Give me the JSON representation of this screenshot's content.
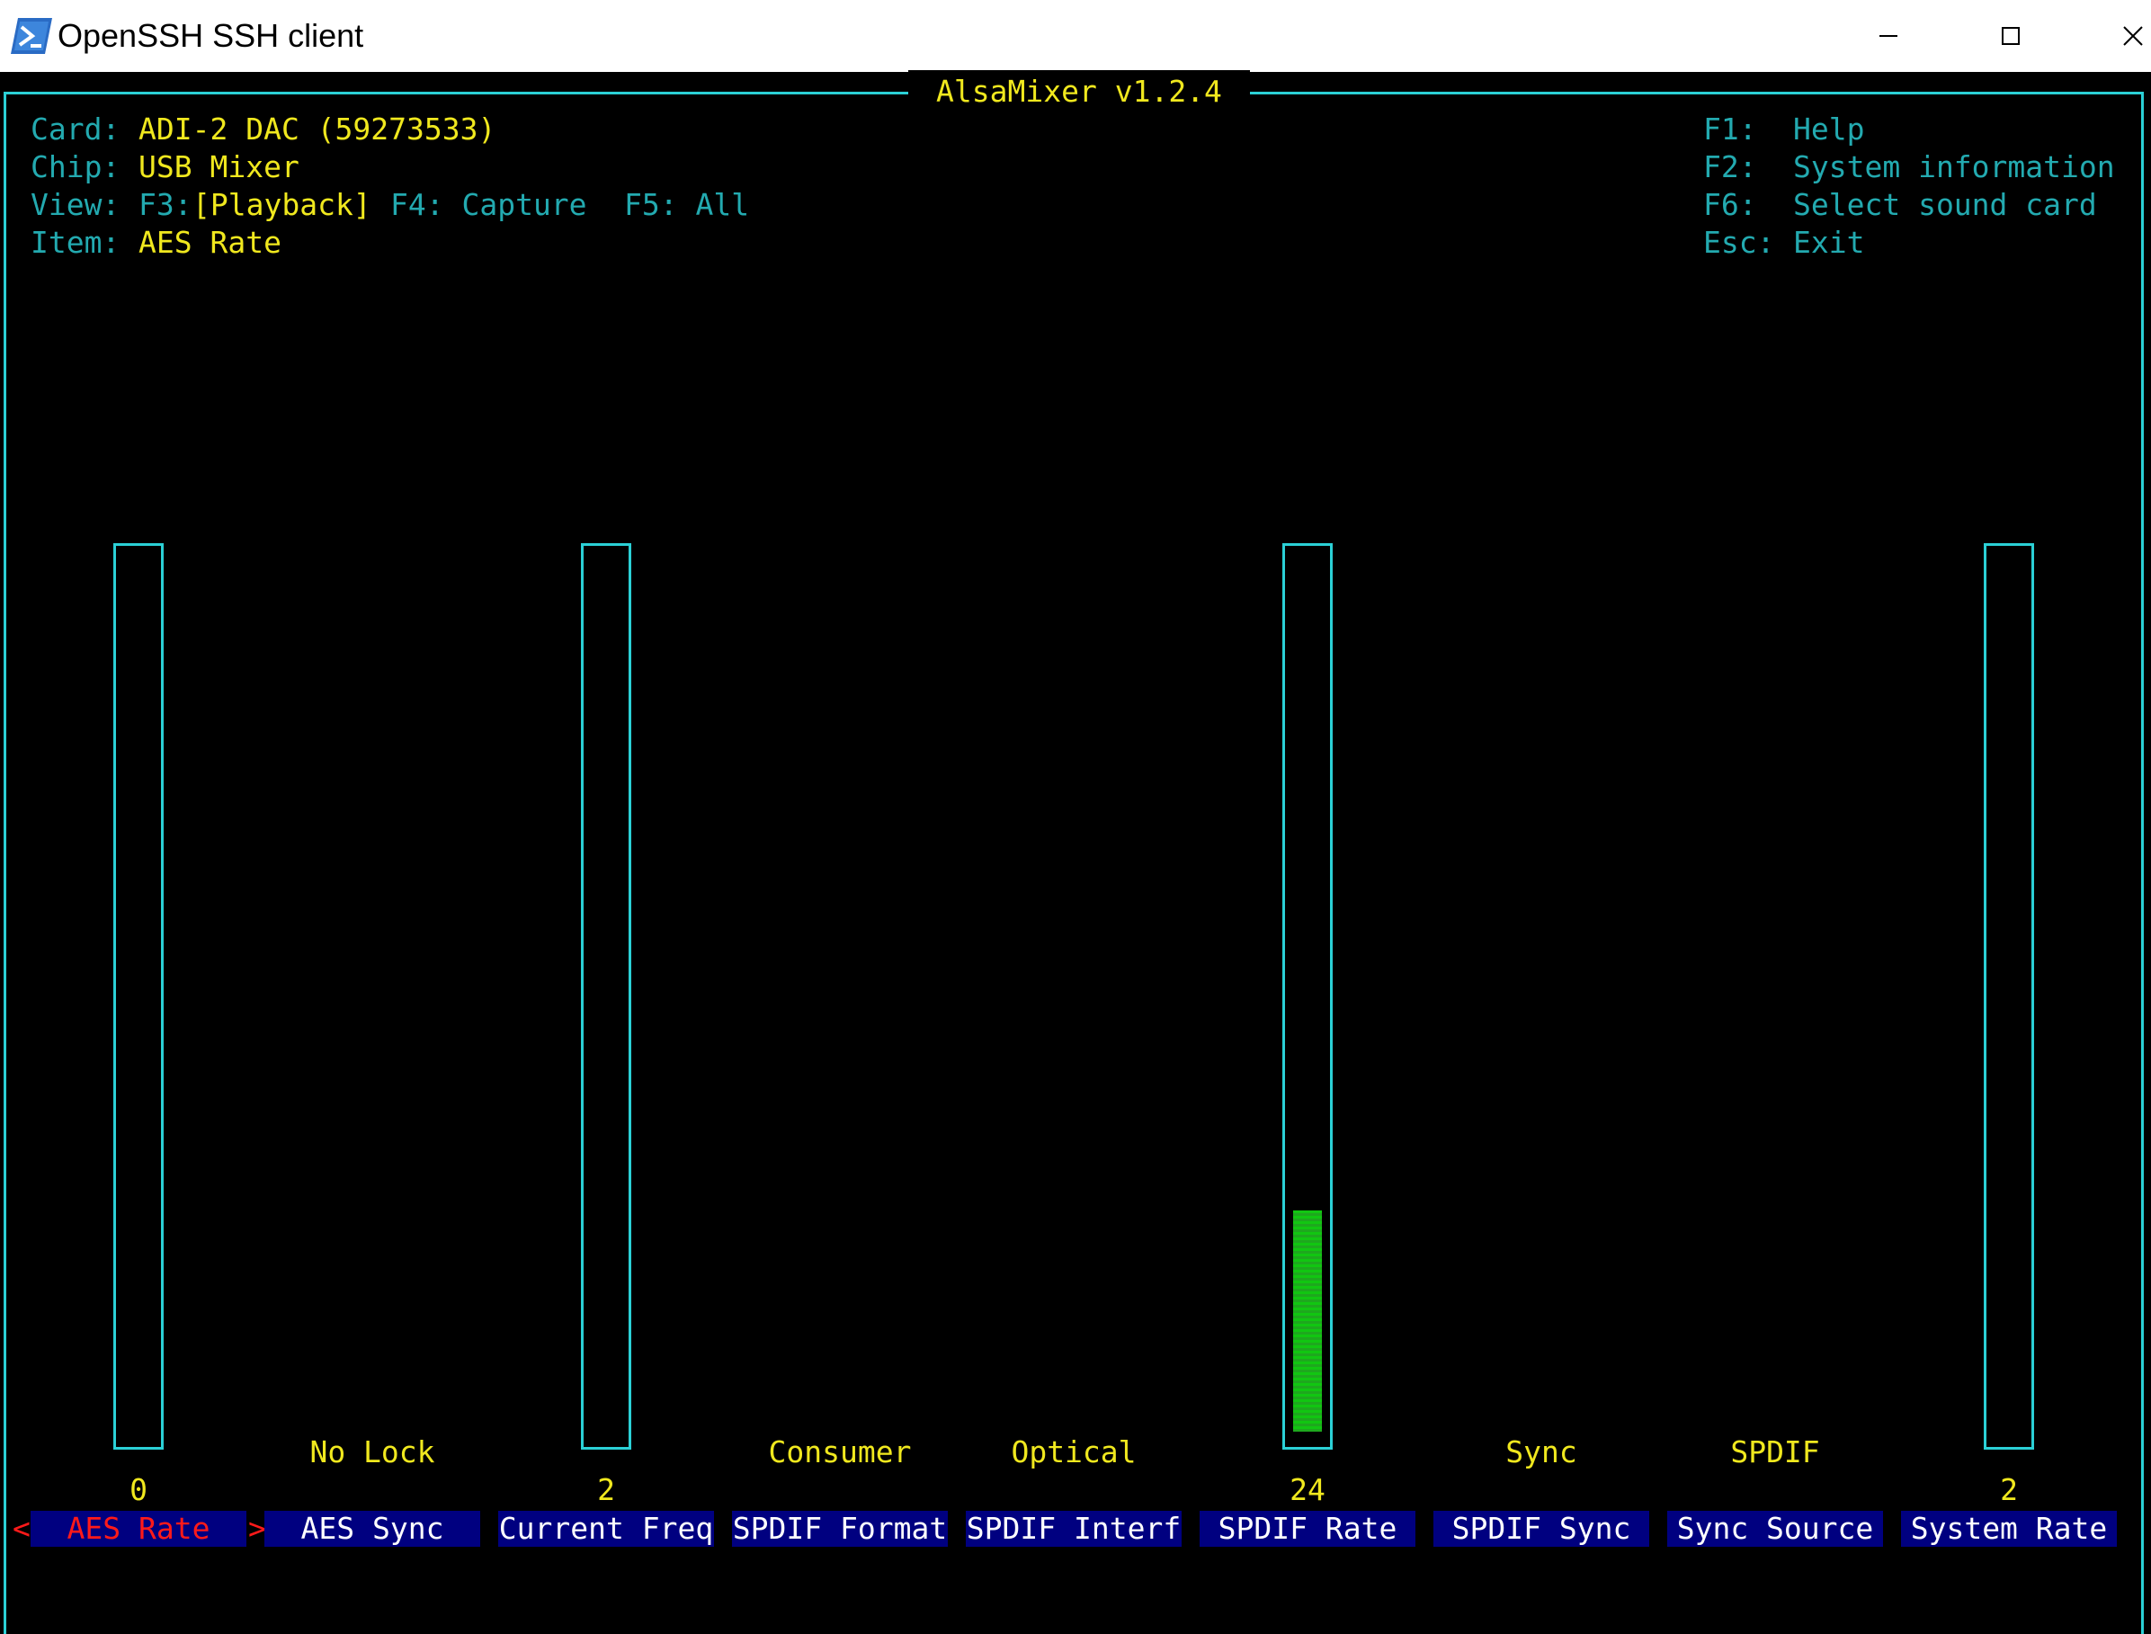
{
  "window": {
    "title": "OpenSSH SSH client",
    "icon": "powershell-icon",
    "buttons": [
      "minimize-icon",
      "maximize-icon",
      "close-icon"
    ]
  },
  "mixer": {
    "title": "AlsaMixer v1.2.4",
    "card_label": "Card:",
    "card_value": "ADI-2 DAC (59273533)",
    "chip_label": "Chip:",
    "chip_value": "USB Mixer",
    "view_label": "View:",
    "view_f3": "F3:",
    "view_playback": "[Playback]",
    "view_f4": "F4: Capture",
    "view_f5": "F5: All",
    "item_label": "Item:",
    "item_value": "AES Rate"
  },
  "help": {
    "f1_key": "F1:",
    "f1_text": "Help",
    "f2_key": "F2:",
    "f2_text": "System information",
    "f6_key": "F6:",
    "f6_text": "Select sound card",
    "esc_key": "Esc:",
    "esc_text": "Exit"
  },
  "controls": [
    {
      "name": "AES Rate",
      "value": "0",
      "state": "",
      "has_bar": true,
      "level": 0,
      "selected": true
    },
    {
      "name": "AES Sync",
      "value": "",
      "state": "No Lock",
      "has_bar": false,
      "selected": false
    },
    {
      "name": "Current Freq",
      "value": "2",
      "state": "",
      "has_bar": true,
      "level": 0,
      "selected": false
    },
    {
      "name": "SPDIF Format",
      "value": "",
      "state": "Consumer",
      "has_bar": false,
      "selected": false
    },
    {
      "name": "SPDIF Interf",
      "value": "",
      "state": "Optical",
      "has_bar": false,
      "selected": false
    },
    {
      "name": "SPDIF Rate",
      "value": "24",
      "state": "",
      "has_bar": true,
      "level": 0.25,
      "selected": false
    },
    {
      "name": "SPDIF Sync",
      "value": "",
      "state": "Sync",
      "has_bar": false,
      "selected": false
    },
    {
      "name": "Sync Source",
      "value": "",
      "state": "SPDIF",
      "has_bar": false,
      "selected": false
    },
    {
      "name": "System Rate",
      "value": "2",
      "state": "",
      "has_bar": true,
      "level": 0,
      "selected": false
    }
  ],
  "selection_markers": {
    "left": "<",
    "right": ">"
  },
  "colors": {
    "frame": "#2bd0d6",
    "label_text": "#23aab0",
    "value_text": "#f0e81e",
    "label_bg": "#000080",
    "selected_text": "#ff1a1a",
    "bar_fill": "#11c611"
  }
}
